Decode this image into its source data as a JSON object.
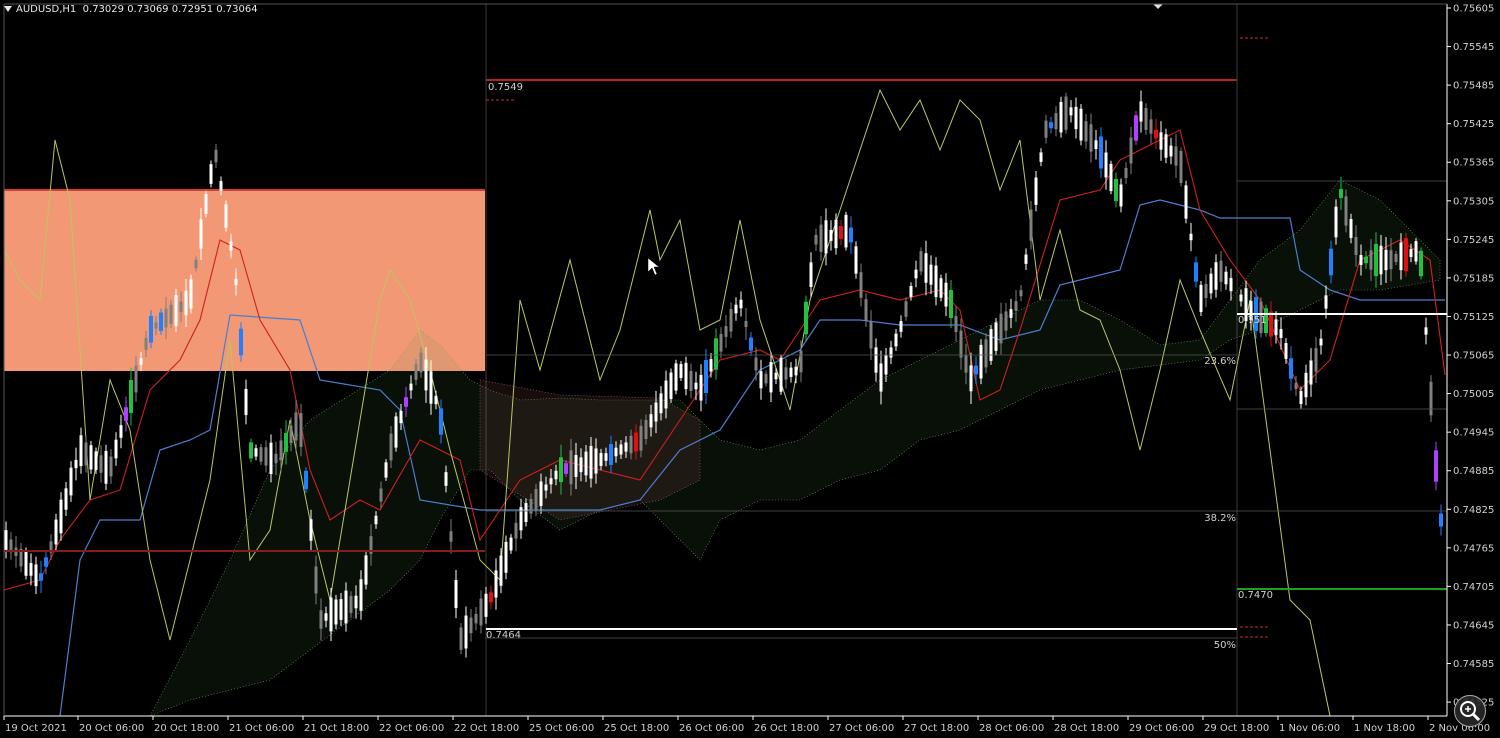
{
  "window": {
    "symbol": "AUDUSD,H1",
    "ohlc": "0.73029 0.73069 0.72951 0.73064"
  },
  "colors": {
    "background": "#000000",
    "axis": "#ffffff",
    "text": "#d0d0d0",
    "supply_zone": "#FFA07A",
    "resistance_line": "#B22222",
    "support_line": "#ffffff",
    "green_line": "#1aa31a",
    "kijun": "#4a7fd0",
    "tenkan": "#d02020",
    "chikou": "#b8c860",
    "bull_candle": "#ffffff",
    "bear_candle": "#808080",
    "blue_bar": "#2080ff",
    "red_bar": "#e01010",
    "green_bar": "#20c040",
    "purple_bar": "#b040ff"
  },
  "levels": {
    "resistance": "0.7549",
    "support": "0.7464",
    "right_green": "0.7470",
    "right_white": "0.751"
  },
  "fib_labels": [
    "23.6%",
    "38.2%",
    "50%"
  ],
  "chart_data": {
    "type": "candlestick",
    "symbol": "AUDUSD",
    "timeframe": "H1",
    "last_ohlc": {
      "open": 0.73029,
      "high": 0.73069,
      "low": 0.72951,
      "close": 0.73064
    },
    "y_ticks": [
      "0.75605",
      "0.75545",
      "0.75485",
      "0.75425",
      "0.75365",
      "0.75305",
      "0.75245",
      "0.75185",
      "0.75125",
      "0.75065",
      "0.75005",
      "0.74945",
      "0.74885",
      "0.74825",
      "0.74765",
      "0.74705",
      "0.74645",
      "0.74585",
      "0.74525"
    ],
    "x_ticks": [
      "19 Oct 2021",
      "20 Oct 06:00",
      "20 Oct 18:00",
      "21 Oct 06:00",
      "21 Oct 18:00",
      "22 Oct 06:00",
      "22 Oct 18:00",
      "25 Oct 06:00",
      "25 Oct 18:00",
      "26 Oct 06:00",
      "26 Oct 18:00",
      "27 Oct 06:00",
      "27 Oct 18:00",
      "28 Oct 06:00",
      "28 Oct 18:00",
      "29 Oct 06:00",
      "29 Oct 18:00",
      "1 Nov 06:00",
      "1 Nov 18:00",
      "2 Nov 06:00"
    ],
    "ylim": [
      0.745,
      0.7562
    ],
    "indicators": [
      "Ichimoku Kinko Hyo",
      "Fibonacci retracement",
      "Rectangle zone"
    ]
  }
}
